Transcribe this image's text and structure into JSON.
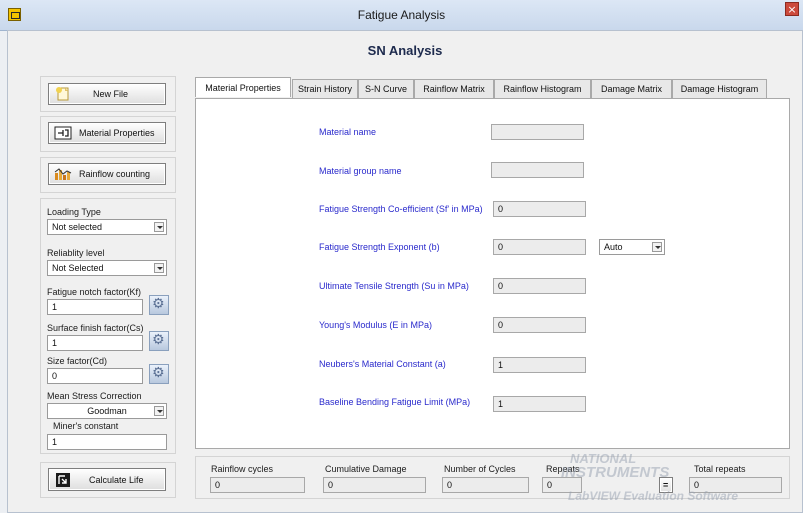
{
  "window": {
    "title": "Fatigue Analysis",
    "close_glyph": "×"
  },
  "heading": "SN Analysis",
  "left_panel": {
    "new_file_label": "New File",
    "material_properties_label": "Material Properties",
    "rainflow_counting_label": "Rainflow counting",
    "loading_type": {
      "label": "Loading Type",
      "value": "Not selected"
    },
    "reliability_level": {
      "label": "Reliablity level",
      "value": "Not Selected"
    },
    "fatigue_notch": {
      "label": "Fatigue notch factor(Kf)",
      "value": "1"
    },
    "surface_finish": {
      "label": "Surface finish factor(Cs)",
      "value": "1"
    },
    "size_factor": {
      "label": "Size factor(Cd)",
      "value": "0"
    },
    "mean_stress": {
      "label": "Mean Stress Correction",
      "value": "Goodman"
    },
    "miners_constant": {
      "label": "Miner's constant",
      "value": "1"
    },
    "calculate_life_label": "Calculate Life"
  },
  "tabs": [
    {
      "label": "Material Properties",
      "active": true
    },
    {
      "label": "Strain History",
      "active": false
    },
    {
      "label": "S-N Curve",
      "active": false
    },
    {
      "label": "Rainflow Matrix",
      "active": false
    },
    {
      "label": "Rainflow Histogram",
      "active": false
    },
    {
      "label": "Damage Matrix",
      "active": false
    },
    {
      "label": "Damage Histogram",
      "active": false
    }
  ],
  "material": {
    "name": {
      "label": "Material name",
      "value": ""
    },
    "group": {
      "label": "Material group name",
      "value": ""
    },
    "strength_coeff": {
      "label": "Fatigue Strength Co-efficient (Sf' in MPa)",
      "value": "0"
    },
    "strength_exp": {
      "label": "Fatigue Strength Exponent (b)",
      "value": "0",
      "mode": "Auto"
    },
    "uts": {
      "label": "Ultimate Tensile Strength (Su in MPa)",
      "value": "0"
    },
    "youngs": {
      "label": "Young's Modulus (E in MPa)",
      "value": "0"
    },
    "neuber": {
      "label": "Neubers's Material Constant (a)",
      "value": "1"
    },
    "baseline": {
      "label": "Baseline Bending Fatigue Limit (MPa)",
      "value": "1"
    }
  },
  "bottom": {
    "rainflow_cycles": {
      "label": "Rainflow cycles",
      "value": "0"
    },
    "cumulative_damage": {
      "label": "Cumulative Damage",
      "value": "0"
    },
    "number_of_cycles": {
      "label": "Number of Cycles",
      "value": "0"
    },
    "repeats": {
      "label": "Repeats",
      "value": "0"
    },
    "equals": "=",
    "total_repeats": {
      "label": "Total repeats",
      "value": "0"
    }
  },
  "watermark": {
    "line1": "NATIONAL",
    "line2": "INSTRUMENTS",
    "line3": "LabVIEW Evaluation Software"
  },
  "colors": {
    "accent": "#2a2acc",
    "title_bg": "#cad9ed",
    "close": "#cc4a3c"
  }
}
